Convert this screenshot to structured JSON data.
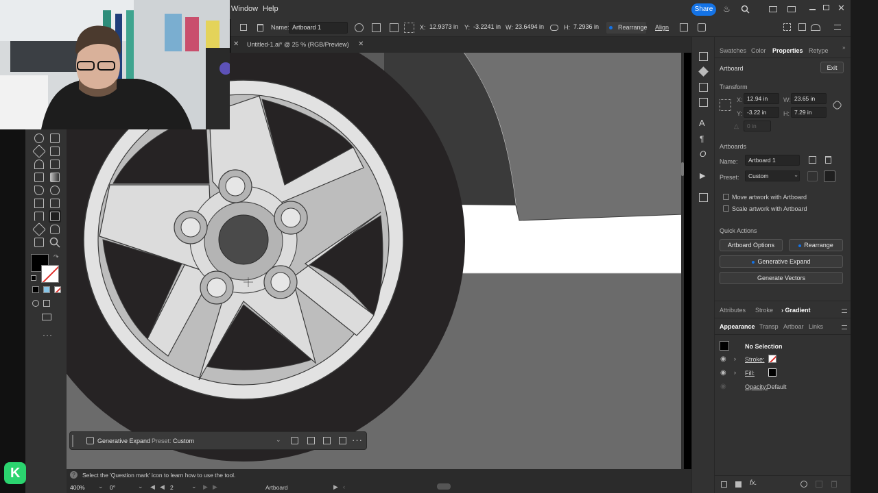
{
  "menubar": {
    "items": [
      "Window",
      "Help"
    ],
    "share_label": "Share"
  },
  "controlbar": {
    "name_label": "Name:",
    "artboard_name": "Artboard 1",
    "x_label": "X:",
    "x_value": "12.9373 in",
    "y_label": "Y:",
    "y_value": "-3.2241 in",
    "w_label": "W:",
    "w_value": "23.6494 in",
    "h_label": "H:",
    "h_value": "7.2936 in",
    "rearrange_label": "Rearrange",
    "align_label": "Align"
  },
  "document": {
    "tab_title": "Untitled-1.ai* @ 25 % (RGB/Preview)"
  },
  "context_bar": {
    "generative_expand_label": "Generative Expand",
    "preset_label": "Preset:",
    "preset_value": "Custom"
  },
  "hint": {
    "text": "Select the 'Question mark' icon to learn how to use the tool."
  },
  "status": {
    "zoom": "400%",
    "angle": "0°",
    "artboard_number": "2",
    "tool_name": "Artboard"
  },
  "panel": {
    "tabs": [
      "Swatches",
      "Color",
      "Properties",
      "Retype"
    ],
    "active_tab": "Properties",
    "section_artboard": "Artboard",
    "exit_label": "Exit",
    "transform_heading": "Transform",
    "x_label": "X:",
    "x_value": "12.94 in",
    "y_label": "Y:",
    "y_value": "-3.22 in",
    "w_label": "W:",
    "w_value": "23.65 in",
    "h_label": "H:",
    "h_value": "7.29 in",
    "rotate_value": "0 in",
    "artboards_heading": "Artboards",
    "name_label": "Name:",
    "artboard_name": "Artboard 1",
    "preset_label": "Preset:",
    "preset_value": "Custom",
    "move_artwork_label": "Move artwork with Artboard",
    "scale_artwork_label": "Scale artwork with Artboard",
    "quick_actions_heading": "Quick Actions",
    "artboard_options_label": "Artboard Options",
    "rearrange_label": "Rearrange",
    "generative_expand_label": "Generative Expand",
    "generate_vectors_label": "Generate Vectors"
  },
  "panel2": {
    "tabs": [
      "Attributes",
      "Stroke",
      "Gradient"
    ],
    "active_tab": "Gradient",
    "sub_tabs": [
      "Appearance",
      "Transp",
      "Artboar",
      "Links"
    ],
    "active_sub_tab": "Appearance",
    "selection_label": "No Selection",
    "stroke_label": "Stroke:",
    "fill_label": "Fill:",
    "opacity_label": "Opacity:",
    "opacity_value": "Default"
  },
  "colors": {
    "ui_bg": "#323232",
    "canvas_bg": "#6b6b6b",
    "tire": "#262324",
    "rim_light": "#dcdcdc",
    "rim_mid": "#b4b4b4",
    "accent_blue": "#1473e6"
  },
  "icons": [
    "share-icon",
    "bell-icon",
    "search-icon",
    "close-icon",
    "eye-icon",
    "chevron-right-icon",
    "trash-icon",
    "fx-icon"
  ]
}
